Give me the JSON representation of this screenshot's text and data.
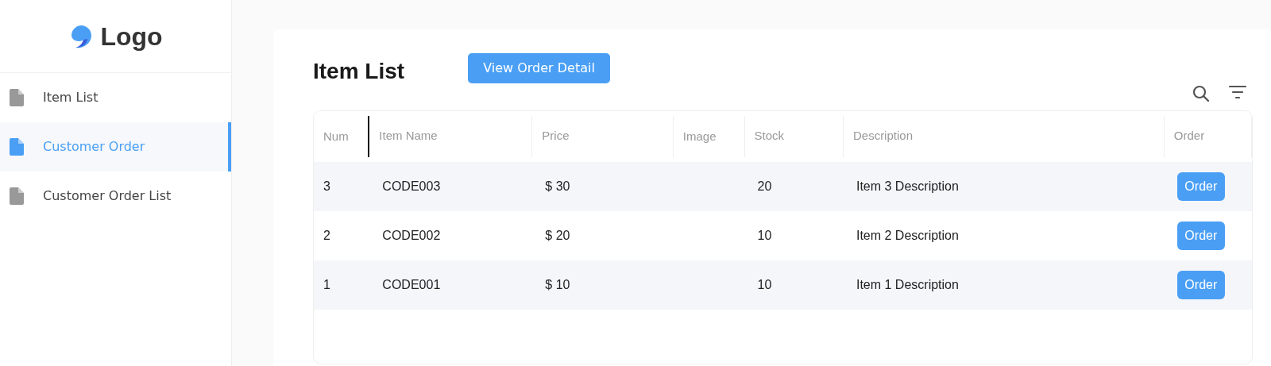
{
  "logo": {
    "text": "Logo"
  },
  "sidebar": {
    "items": [
      {
        "label": "Item List",
        "selected": false
      },
      {
        "label": "Customer Order",
        "selected": true
      },
      {
        "label": "Customer Order List",
        "selected": false
      }
    ]
  },
  "page": {
    "title": "Item List",
    "action_button": "View Order Detail"
  },
  "table": {
    "columns": [
      "Num",
      "Item Name",
      "Price",
      "Image",
      "Stock",
      "Description",
      "Order"
    ],
    "rows": [
      {
        "num": "3",
        "name": "CODE003",
        "price": "$ 30",
        "stock": "20",
        "description": "Item 3 Description",
        "button": "Order"
      },
      {
        "num": "2",
        "name": "CODE002",
        "price": "$ 20",
        "stock": "10",
        "description": "Item 2 Description",
        "button": "Order"
      },
      {
        "num": "1",
        "name": "CODE001",
        "price": "$ 10",
        "stock": "10",
        "description": "Item 1 Description",
        "button": "Order"
      }
    ]
  }
}
